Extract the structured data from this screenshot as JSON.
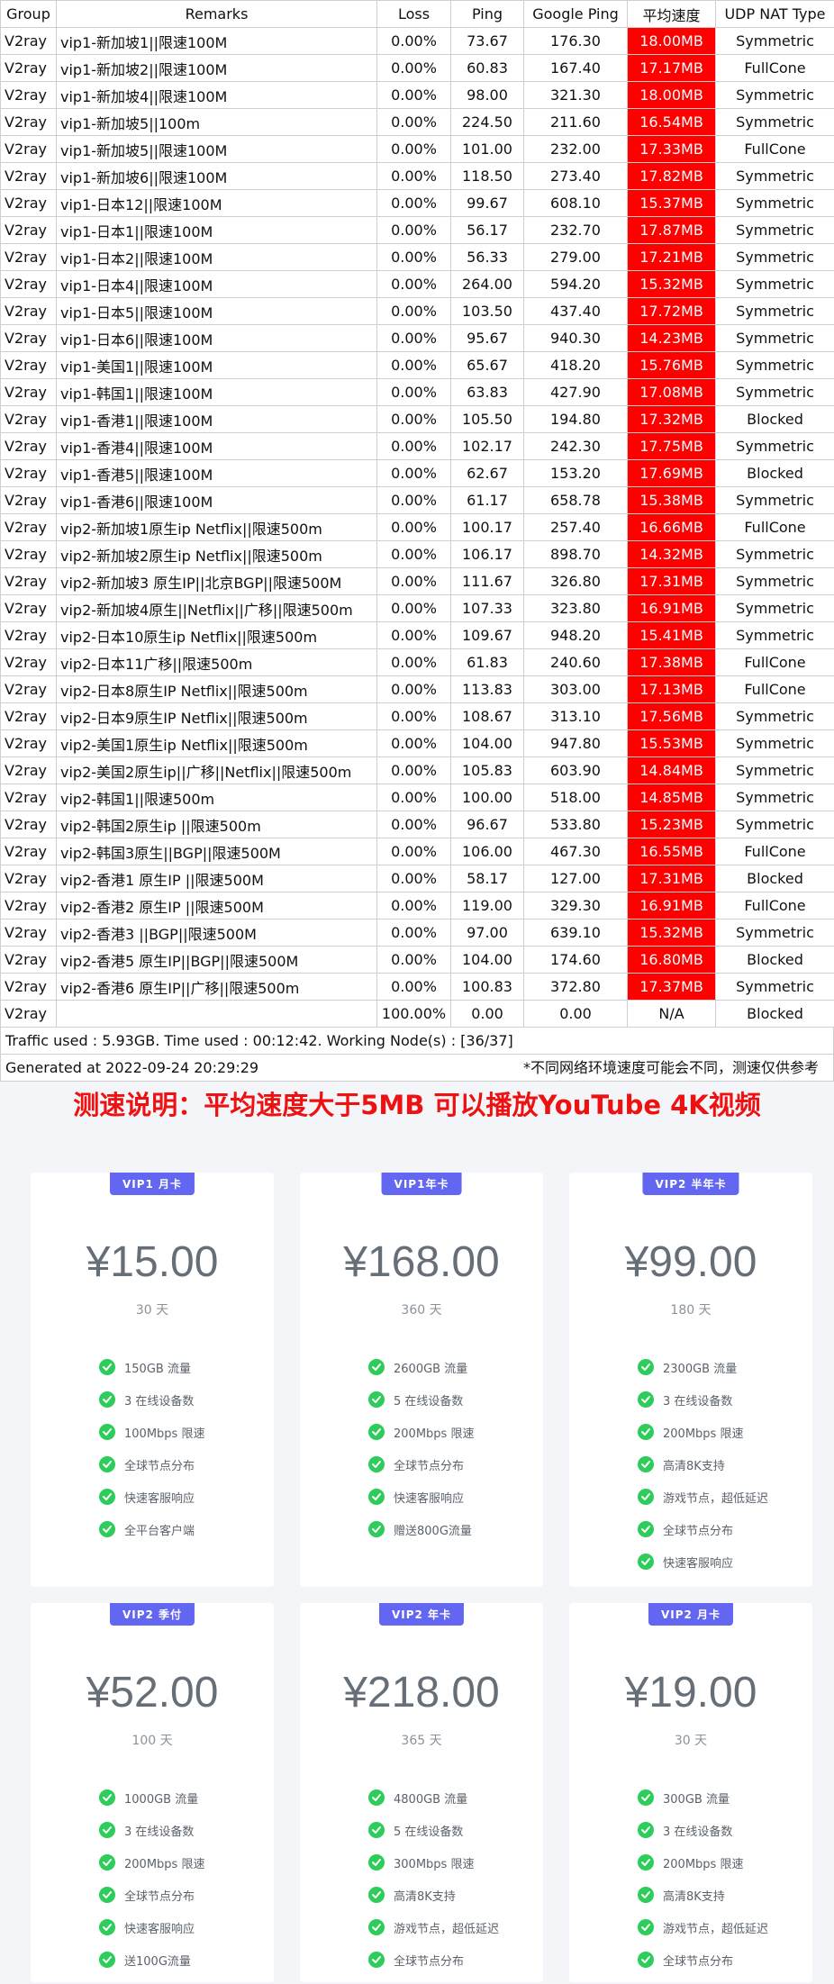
{
  "headers": [
    "Group",
    "Remarks",
    "Loss",
    "Ping",
    "Google Ping",
    "平均速度",
    "UDP NAT Type"
  ],
  "rows": [
    [
      "V2ray",
      "vip1-新加坡1||限速100M",
      "0.00%",
      "73.67",
      "176.30",
      "18.00MB",
      "Symmetric"
    ],
    [
      "V2ray",
      "vip1-新加坡2||限速100M",
      "0.00%",
      "60.83",
      "167.40",
      "17.17MB",
      "FullCone"
    ],
    [
      "V2ray",
      "vip1-新加坡4||限速100M",
      "0.00%",
      "98.00",
      "321.30",
      "18.00MB",
      "Symmetric"
    ],
    [
      "V2ray",
      "vip1-新加坡5||100m",
      "0.00%",
      "224.50",
      "211.60",
      "16.54MB",
      "Symmetric"
    ],
    [
      "V2ray",
      "vip1-新加坡5||限速100M",
      "0.00%",
      "101.00",
      "232.00",
      "17.33MB",
      "FullCone"
    ],
    [
      "V2ray",
      "vip1-新加坡6||限速100M",
      "0.00%",
      "118.50",
      "273.40",
      "17.82MB",
      "Symmetric"
    ],
    [
      "V2ray",
      "vip1-日本12||限速100M",
      "0.00%",
      "99.67",
      "608.10",
      "15.37MB",
      "Symmetric"
    ],
    [
      "V2ray",
      "vip1-日本1||限速100M",
      "0.00%",
      "56.17",
      "232.70",
      "17.87MB",
      "Symmetric"
    ],
    [
      "V2ray",
      "vip1-日本2||限速100M",
      "0.00%",
      "56.33",
      "279.00",
      "17.21MB",
      "Symmetric"
    ],
    [
      "V2ray",
      "vip1-日本4||限速100M",
      "0.00%",
      "264.00",
      "594.20",
      "15.32MB",
      "Symmetric"
    ],
    [
      "V2ray",
      "vip1-日本5||限速100M",
      "0.00%",
      "103.50",
      "437.40",
      "17.72MB",
      "Symmetric"
    ],
    [
      "V2ray",
      "vip1-日本6||限速100M",
      "0.00%",
      "95.67",
      "940.30",
      "14.23MB",
      "Symmetric"
    ],
    [
      "V2ray",
      "vip1-美国1||限速100M",
      "0.00%",
      "65.67",
      "418.20",
      "15.76MB",
      "Symmetric"
    ],
    [
      "V2ray",
      "vip1-韩国1||限速100M",
      "0.00%",
      "63.83",
      "427.90",
      "17.08MB",
      "Symmetric"
    ],
    [
      "V2ray",
      "vip1-香港1||限速100M",
      "0.00%",
      "105.50",
      "194.80",
      "17.32MB",
      "Blocked"
    ],
    [
      "V2ray",
      "vip1-香港4||限速100M",
      "0.00%",
      "102.17",
      "242.30",
      "17.75MB",
      "Symmetric"
    ],
    [
      "V2ray",
      "vip1-香港5||限速100M",
      "0.00%",
      "62.67",
      "153.20",
      "17.69MB",
      "Blocked"
    ],
    [
      "V2ray",
      "vip1-香港6||限速100M",
      "0.00%",
      "61.17",
      "658.78",
      "15.38MB",
      "Symmetric"
    ],
    [
      "V2ray",
      "vip2-新加坡1原生ip Netflix||限速500m",
      "0.00%",
      "100.17",
      "257.40",
      "16.66MB",
      "FullCone"
    ],
    [
      "V2ray",
      "vip2-新加坡2原生ip Netflix||限速500m",
      "0.00%",
      "106.17",
      "898.70",
      "14.32MB",
      "Symmetric"
    ],
    [
      "V2ray",
      "vip2-新加坡3 原生IP||北京BGP||限速500M",
      "0.00%",
      "111.67",
      "326.80",
      "17.31MB",
      "Symmetric"
    ],
    [
      "V2ray",
      "vip2-新加坡4原生||Netflix||广移||限速500m",
      "0.00%",
      "107.33",
      "323.80",
      "16.91MB",
      "Symmetric"
    ],
    [
      "V2ray",
      "vip2-日本10原生ip Netflix||限速500m",
      "0.00%",
      "109.67",
      "948.20",
      "15.41MB",
      "Symmetric"
    ],
    [
      "V2ray",
      "vip2-日本11广移||限速500m",
      "0.00%",
      "61.83",
      "240.60",
      "17.38MB",
      "FullCone"
    ],
    [
      "V2ray",
      "vip2-日本8原生IP Netflix||限速500m",
      "0.00%",
      "113.83",
      "303.00",
      "17.13MB",
      "FullCone"
    ],
    [
      "V2ray",
      "vip2-日本9原生IP Netflix||限速500m",
      "0.00%",
      "108.67",
      "313.10",
      "17.56MB",
      "Symmetric"
    ],
    [
      "V2ray",
      "vip2-美国1原生ip Netflix||限速500m",
      "0.00%",
      "104.00",
      "947.80",
      "15.53MB",
      "Symmetric"
    ],
    [
      "V2ray",
      "vip2-美国2原生ip||广移||Netflix||限速500m",
      "0.00%",
      "105.83",
      "603.90",
      "14.84MB",
      "Symmetric"
    ],
    [
      "V2ray",
      "vip2-韩国1||限速500m",
      "0.00%",
      "100.00",
      "518.00",
      "14.85MB",
      "Symmetric"
    ],
    [
      "V2ray",
      "vip2-韩国2原生ip ||限速500m",
      "0.00%",
      "96.67",
      "533.80",
      "15.23MB",
      "Symmetric"
    ],
    [
      "V2ray",
      "vip2-韩国3原生||BGP||限速500M",
      "0.00%",
      "106.00",
      "467.30",
      "16.55MB",
      "FullCone"
    ],
    [
      "V2ray",
      "vip2-香港1 原生IP ||限速500M",
      "0.00%",
      "58.17",
      "127.00",
      "17.31MB",
      "Blocked"
    ],
    [
      "V2ray",
      "vip2-香港2 原生IP ||限速500M",
      "0.00%",
      "119.00",
      "329.30",
      "16.91MB",
      "FullCone"
    ],
    [
      "V2ray",
      "vip2-香港3 ||BGP||限速500M",
      "0.00%",
      "97.00",
      "639.10",
      "15.32MB",
      "Symmetric"
    ],
    [
      "V2ray",
      "vip2-香港5 原生IP||BGP||限速500M",
      "0.00%",
      "104.00",
      "174.60",
      "16.80MB",
      "Blocked"
    ],
    [
      "V2ray",
      "vip2-香港6 原生IP||广移||限速500m",
      "0.00%",
      "100.83",
      "372.80",
      "17.37MB",
      "Symmetric"
    ],
    [
      "V2ray",
      "",
      "100.00%",
      "0.00",
      "0.00",
      "N/A",
      "Blocked"
    ]
  ],
  "colors": {
    "speed_highlight": "#ff0000",
    "badge": "#6366f1",
    "check": "#2ecc5b",
    "promo_text": "#ee1111"
  },
  "summary": "Traffic used : 5.93GB. Time used : 00:12:42. Working Node(s) : [36/37]",
  "generated": "Generated at 2022-09-24 20:29:29",
  "footnote": "*不同网络环境速度可能会不同，测速仅供参考",
  "promo": "测速说明：平均速度大于5MB 可以播放YouTube 4K视频",
  "plans": [
    {
      "badge": "VIP1 月卡",
      "price": "¥15.00",
      "period": "30 天",
      "features": [
        "150GB 流量",
        "3 在线设备数",
        "100Mbps 限速",
        "全球节点分布",
        "快速客服响应",
        "全平台客户端"
      ]
    },
    {
      "badge": "VIP1年卡",
      "price": "¥168.00",
      "period": "360 天",
      "features": [
        "2600GB 流量",
        "5 在线设备数",
        "200Mbps 限速",
        "全球节点分布",
        "快速客服响应",
        "赠送800G流量"
      ]
    },
    {
      "badge": "VIP2 半年卡",
      "price": "¥99.00",
      "period": "180 天",
      "features": [
        "2300GB 流量",
        "3 在线设备数",
        "200Mbps 限速",
        "高清8K支持",
        "游戏节点，超低延迟",
        "全球节点分布",
        "快速客服响应"
      ]
    },
    {
      "badge": "VIP2 季付",
      "price": "¥52.00",
      "period": "100 天",
      "features": [
        "1000GB 流量",
        "3 在线设备数",
        "200Mbps 限速",
        "全球节点分布",
        "快速客服响应",
        "送100G流量"
      ]
    },
    {
      "badge": "VIP2 年卡",
      "price": "¥218.00",
      "period": "365 天",
      "features": [
        "4800GB 流量",
        "5 在线设备数",
        "300Mbps 限速",
        "高清8K支持",
        "游戏节点，超低延迟",
        "全球节点分布"
      ]
    },
    {
      "badge": "VIP2 月卡",
      "price": "¥19.00",
      "period": "30 天",
      "features": [
        "300GB 流量",
        "3 在线设备数",
        "200Mbps 限速",
        "高清8K支持",
        "游戏节点，超低延迟",
        "全球节点分布"
      ]
    }
  ]
}
